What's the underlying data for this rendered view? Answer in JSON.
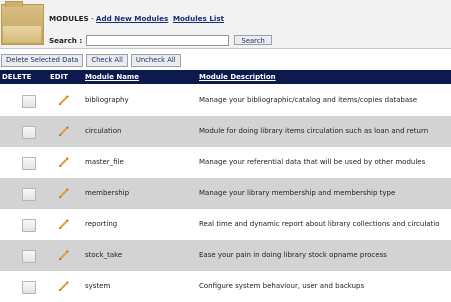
{
  "header": {
    "title": "MODULES",
    "separator": " - ",
    "add_link": "Add New Modules",
    "list_link": "Modules List",
    "search_label": "Search :",
    "search_value": "",
    "search_button": "Search"
  },
  "actions": {
    "delete_selected": "Delete Selected Data",
    "check_all": "Check All",
    "uncheck_all": "Uncheck All"
  },
  "table": {
    "columns": [
      "DELETE",
      "EDIT",
      "Module Name",
      "Module Description"
    ],
    "rows": [
      {
        "name": "bibliography",
        "description": "Manage your bibliographic/catalog and items/copies database"
      },
      {
        "name": "circulation",
        "description": "Module for doing library items circulation such as loan and return"
      },
      {
        "name": "master_file",
        "description": "Manage your referential data that will be used by other modules"
      },
      {
        "name": "membership",
        "description": "Manage your library membership and membership type"
      },
      {
        "name": "reporting",
        "description": "Real time and dynamic report about library collections and circulatio"
      },
      {
        "name": "stock_take",
        "description": "Ease your pain in doing library stock opname process"
      },
      {
        "name": "system",
        "description": "Configure system behaviour, user and backups"
      }
    ]
  },
  "colors": {
    "header_bg": "#0c1a4e",
    "alt_row": "#d3d3d3",
    "link": "#1a2e78"
  }
}
